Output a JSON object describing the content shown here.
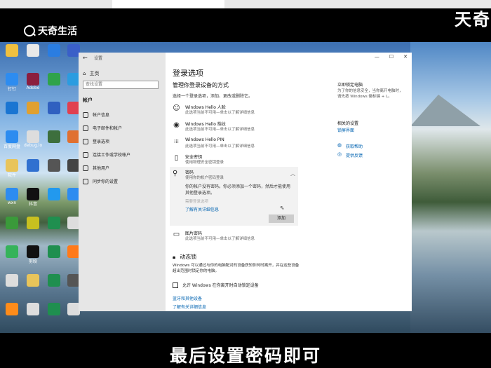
{
  "watermark": {
    "brand_left": "天奇生活",
    "brand_right": "天奇"
  },
  "subtitle": "最后设置密码即可",
  "desktop_icons": [
    {
      "label": "",
      "color": "#f0c040"
    },
    {
      "label": "",
      "color": "#e8e8e8"
    },
    {
      "label": "",
      "color": "#2a7de1"
    },
    {
      "label": "",
      "color": "#3a5fc8"
    },
    {
      "label": "钉钉",
      "color": "#2d8cf0"
    },
    {
      "label": "Adobe",
      "color": "#8b1e3f"
    },
    {
      "label": "",
      "color": "#2fa34a"
    },
    {
      "label": "",
      "color": "#2b9ce0"
    },
    {
      "label": "",
      "color": "#1a75d2"
    },
    {
      "label": "",
      "color": "#e0a030"
    },
    {
      "label": "",
      "color": "#3060c0"
    },
    {
      "label": "",
      "color": "#e04050"
    },
    {
      "label": "百度网盘",
      "color": "#2d8cf0"
    },
    {
      "label": "debug.log",
      "color": "#ddd"
    },
    {
      "label": "",
      "color": "#3d6f3d"
    },
    {
      "label": "",
      "color": "#e07030"
    },
    {
      "label": "软件",
      "color": "#e8c45a"
    },
    {
      "label": "",
      "color": "#3070d0"
    },
    {
      "label": "",
      "color": "#555"
    },
    {
      "label": "",
      "color": "#444"
    },
    {
      "label": "wxn",
      "color": "#2d8cf0"
    },
    {
      "label": "抖音",
      "color": "#111"
    },
    {
      "label": "",
      "color": "#2299ee"
    },
    {
      "label": "",
      "color": "#2d8cf0"
    },
    {
      "label": "",
      "color": "#3a9a3a"
    },
    {
      "label": "",
      "color": "#c8c020"
    },
    {
      "label": "",
      "color": "#1f8f4f"
    },
    {
      "label": "",
      "color": "#ddd"
    },
    {
      "label": "",
      "color": "#35b35a"
    },
    {
      "label": "剪映",
      "color": "#111"
    },
    {
      "label": "",
      "color": "#1f8f4f"
    },
    {
      "label": "",
      "color": "#ff7a1a"
    },
    {
      "label": "",
      "color": "#ddd"
    },
    {
      "label": "",
      "color": "#e8c45a"
    },
    {
      "label": "",
      "color": "#1f8f4f"
    },
    {
      "label": "",
      "color": "#555"
    },
    {
      "label": "",
      "color": "#ff8c1a"
    },
    {
      "label": "",
      "color": "#ddd"
    },
    {
      "label": "",
      "color": "#1f8f4f"
    },
    {
      "label": "",
      "color": "#ddd"
    }
  ],
  "settings": {
    "back_glyph": "←",
    "app_title": "设置",
    "home_label": "主页",
    "search_placeholder": "查找设置",
    "section": "帐户",
    "nav": [
      {
        "label": "帐户信息"
      },
      {
        "label": "电子邮件和帐户"
      },
      {
        "label": "登录选项"
      },
      {
        "label": "连接工作或学校帐户"
      },
      {
        "label": "其他用户"
      },
      {
        "label": "同步你的设置"
      }
    ],
    "window_controls": {
      "min": "—",
      "max": "☐",
      "close": "✕"
    },
    "page_title": "登录选项",
    "subheading": "管理你登录设备的方式",
    "intro": "选择一个登录选项，添加、更改或删除它。",
    "options": [
      {
        "icon": "☺",
        "title": "Windows Hello 人脸",
        "sub": "此选项当前不可用—单击以了解详细信息"
      },
      {
        "icon": "◉",
        "title": "Windows Hello 指纹",
        "sub": "此选项当前不可用—单击以了解详细信息"
      },
      {
        "icon": "⁞⁞⁞",
        "title": "Windows Hello PIN",
        "sub": "此选项当前不可用—单击以了解详细信息"
      },
      {
        "icon": "▯",
        "title": "安全密钥",
        "sub": "使用物理安全密钥登录"
      }
    ],
    "password": {
      "icon": "🔍",
      "title": "密码",
      "sub": "使用你的帐户密码登录",
      "message": "你的帐户没有密码。你必须添加一个密码，然后才能使用其他登录选项。",
      "dim": "需要登录选项",
      "learn_more": "了解有关详细信息",
      "add_button": "添加"
    },
    "picture_password": {
      "icon": "▭",
      "title": "图片密码",
      "sub": "此选项当前不可用—单击以了解详细信息"
    },
    "dynamic_lock": {
      "title": "动态锁",
      "desc": "Windows 可以通过与你的电脑配对的设备获知你何时离开，并在这些设备超出范围时锁定你的电脑。",
      "checkbox": "允许 Windows 在你离开时自动锁定设备",
      "link1": "蓝牙和其他设备",
      "link2": "了解有关详细信息"
    },
    "right": {
      "title": "立即锁定电脑",
      "text": "为了你的信息安全，当你离开电脑时，请先按 Windows 徽标键 + L。",
      "related_title": "相关的设置",
      "related_link": "锁屏界面",
      "help_link": "获取帮助",
      "feedback_link": "提供反馈"
    }
  }
}
